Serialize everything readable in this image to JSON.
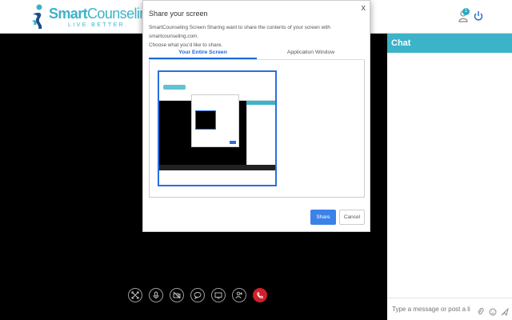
{
  "header": {
    "brand_first": "Smart",
    "brand_second": "Counseling",
    "tagline": "LIVE BETTER.",
    "notification_count": "1",
    "icons": [
      "person-notification-icon",
      "power-icon"
    ]
  },
  "dialog": {
    "title": "Share your screen",
    "close_label": "x",
    "description": "SmartCounseling  Screen Sharing want to share the contents of your screen with smartcounseling.com.",
    "description2": "Choose what you'd like to share.",
    "tabs": [
      {
        "label": "Your Entire Screen",
        "active": true
      },
      {
        "label": "Application Window",
        "active": false
      }
    ],
    "share_label": "Share",
    "cancel_label": "Cancel"
  },
  "chat": {
    "title": "Chat",
    "input_placeholder": "Type a message or post a link",
    "icons": [
      "attachment-icon",
      "emoji-icon",
      "send-icon"
    ]
  },
  "controls": {
    "buttons": [
      "fullscreen-icon",
      "microphone-icon",
      "video-off-icon",
      "chat-bubble-icon",
      "screen-share-icon",
      "add-person-icon",
      "end-call-icon"
    ]
  },
  "colors": {
    "brand": "#3bb3c9",
    "accent": "#1a66d8",
    "end_call": "#d0202a"
  }
}
